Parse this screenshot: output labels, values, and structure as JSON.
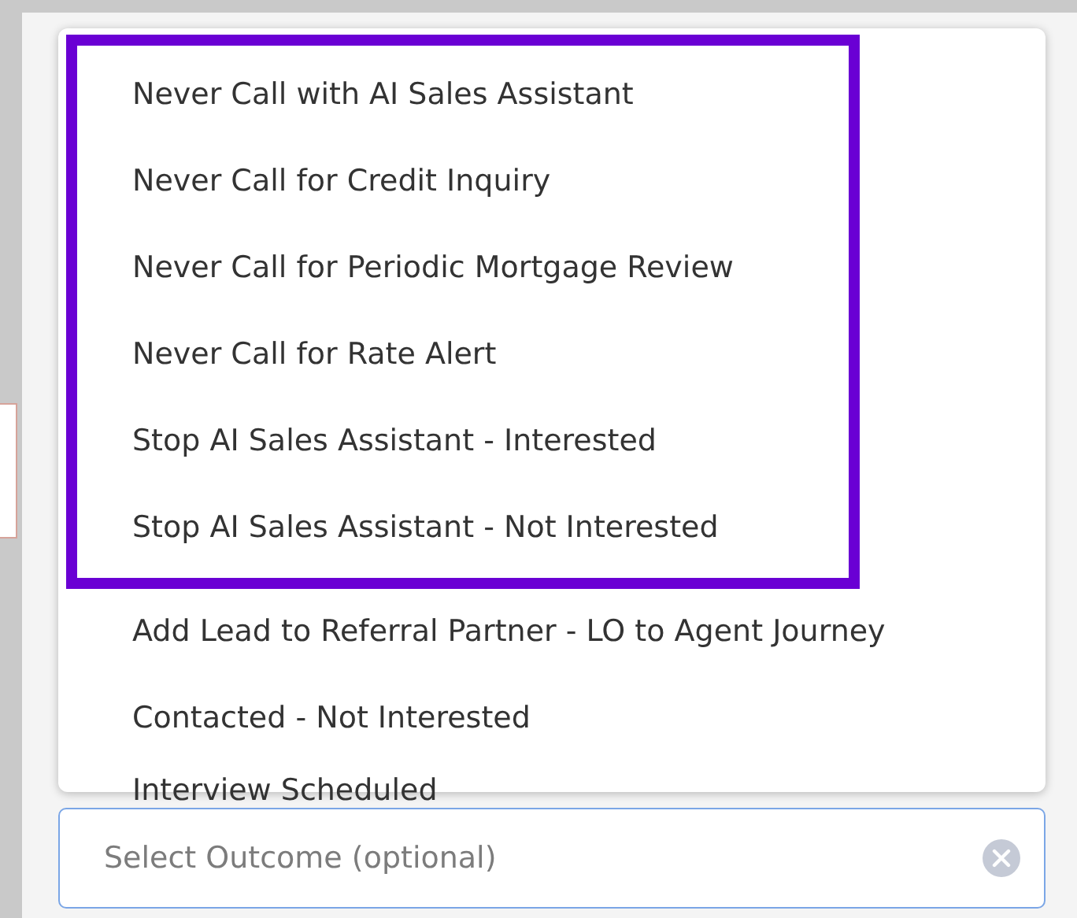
{
  "dropdown": {
    "highlight_frame": {
      "color": "#6a00d4"
    },
    "items": [
      {
        "label": "Never Call with AI Sales Assistant",
        "highlighted": true
      },
      {
        "label": "Never Call for Credit Inquiry",
        "highlighted": true
      },
      {
        "label": "Never Call for Periodic Mortgage Review",
        "highlighted": true
      },
      {
        "label": "Never Call for Rate Alert",
        "highlighted": true
      },
      {
        "label": "Stop AI Sales Assistant - Interested",
        "highlighted": true
      },
      {
        "label": "Stop AI Sales Assistant - Not Interested",
        "highlighted": true
      },
      {
        "label": "Add Lead to Referral Partner - LO to Agent Journey",
        "highlighted": false
      },
      {
        "label": "Contacted - Not Interested",
        "highlighted": false
      },
      {
        "label": "Interview Scheduled",
        "highlighted": false
      }
    ]
  },
  "outcome_field": {
    "placeholder": "Select Outcome (optional)"
  }
}
